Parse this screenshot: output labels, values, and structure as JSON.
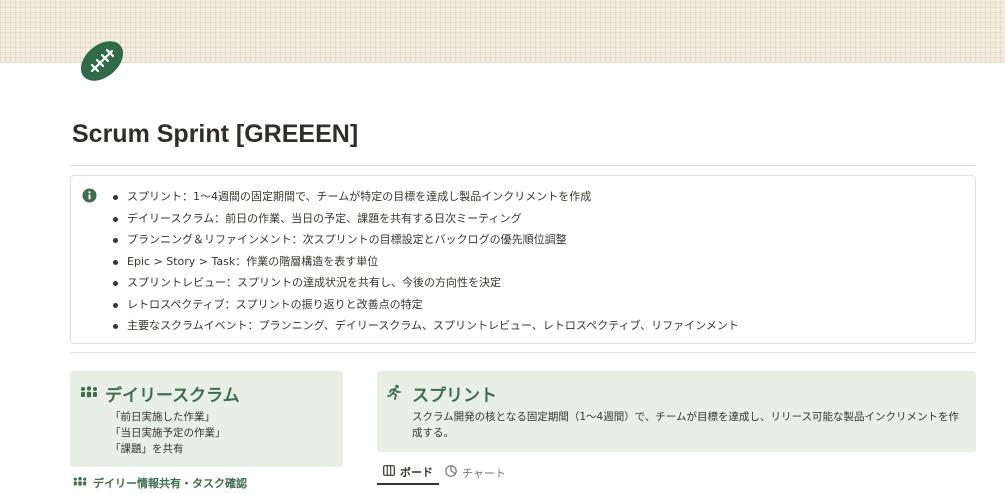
{
  "page": {
    "title": "Scrum Sprint [GREEEN]",
    "icon": "football-icon",
    "accent_color": "#3e6e4c",
    "card_bg_color": "#e8efe5"
  },
  "callout": {
    "icon": "info-icon",
    "items": [
      "スプリント：1〜4週間の固定期間で、チームが特定の目標を達成し製品インクリメントを作成",
      "デイリースクラム：前日の作業、当日の予定、課題を共有する日次ミーティング",
      "プランニング＆リファインメント：次スプリントの目標設定とバックログの優先順位調整",
      "Epic > Story > Task：作業の階層構造を表す単位",
      "スプリントレビュー：スプリントの達成状況を共有し、今後の方向性を決定",
      "レトロスペクティブ：スプリントの振り返りと改善点の特定",
      "主要なスクラムイベント：プランニング、デイリースクラム、スプリントレビュー、レトロスペクティブ、リファインメント"
    ]
  },
  "daily_card": {
    "title": "デイリースクラム",
    "icon": "team-icon",
    "lines": [
      "「前日実施した作業」",
      "「当日実施予定の作業」",
      "「課題」を共有"
    ]
  },
  "daily_link": {
    "label": "デイリー情報共有・タスク確認",
    "icon": "team-icon"
  },
  "sprint_card": {
    "title": "スプリント",
    "icon": "runner-icon",
    "description": "スクラム開発の核となる固定期間（1〜4週間）で、チームが目標を達成し、リリース可能な製品インクリメントを作成する。"
  },
  "view_tabs": [
    {
      "label": "ボード",
      "icon": "board-icon",
      "active": true
    },
    {
      "label": "チャート",
      "icon": "chart-icon",
      "active": false
    }
  ]
}
